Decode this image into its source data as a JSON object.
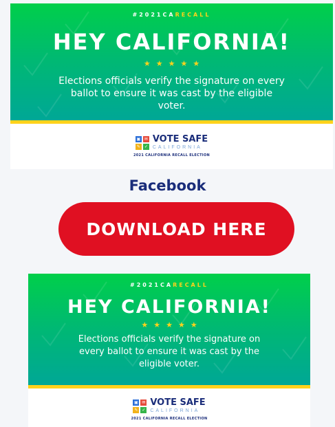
{
  "cards": [
    {
      "hashtag_prefix": "#2021CA",
      "hashtag_highlight": "RECALL",
      "title": "HEY CALIFORNIA!",
      "stars": [
        "★",
        "★",
        "★",
        "★",
        "★"
      ],
      "message": "Elections officials verify the signature on every ballot to ensure it was cast by the eligible voter.",
      "logo_title": "VOTE SAFE",
      "logo_subtitle": "CALIFORNIA",
      "logo_tagline": "2021 CALIFORNIA RECALL ELECTION"
    },
    {
      "hashtag_prefix": "#2021CA",
      "hashtag_highlight": "RECALL",
      "title": "HEY CALIFORNIA!",
      "stars": [
        "★",
        "★",
        "★",
        "★",
        "★"
      ],
      "message": "Elections officials verify the signature on every ballot to ensure it was cast by the eligible voter.",
      "logo_title": "VOTE SAFE",
      "logo_subtitle": "CALIFORNIA",
      "logo_tagline": "2021 CALIFORNIA RECALL ELECTION"
    }
  ],
  "section_label": "Facebook",
  "download_button": "DOWNLOAD HERE",
  "colors": {
    "banner_top": "#00cf4a",
    "banner_bottom": "#00a796",
    "accent_yellow": "#ffd21c",
    "navy": "#1a2d7a",
    "button_red": "#e01022",
    "tile_blue": "#2b6fd8",
    "tile_red": "#e64a3b",
    "tile_yellow": "#f2b21a",
    "tile_green": "#35b44a"
  },
  "icons": {
    "logo_tiles": [
      "ballot-box-icon",
      "envelope-icon",
      "pencil-icon",
      "checkmark-icon"
    ],
    "background_pattern": "checkmark-pattern-icon"
  }
}
